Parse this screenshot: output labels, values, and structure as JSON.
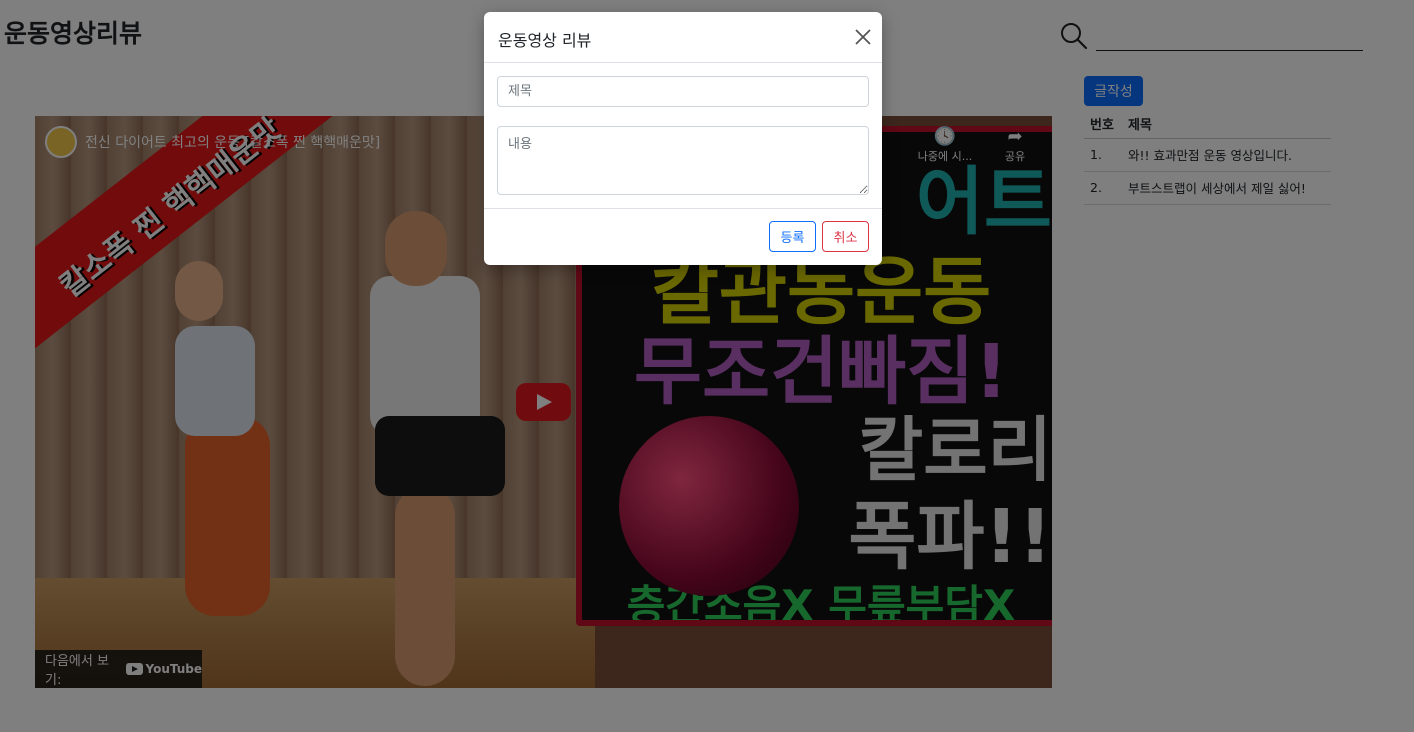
{
  "site": {
    "title": "운동영상리뷰"
  },
  "search": {
    "placeholder": ""
  },
  "toolbar": {
    "write_label": "글작성"
  },
  "table": {
    "headers": [
      "번호",
      "제목"
    ],
    "rows": [
      {
        "num": "1.",
        "title": "와!! 효과만점 운동 영상입니다."
      },
      {
        "num": "2.",
        "title": "부트스트랩이 세상에서 제일 싫어!"
      }
    ]
  },
  "video": {
    "title": "전신 다이어트 최고의 운동 [칼소폭 찐 핵핵매운맛]",
    "watch_later": "나중에 시...",
    "share": "공유",
    "watch_on": "다음에서 보기:",
    "youtube": "YouTube",
    "banner": "칼소폭 찐 핵핵매운맛",
    "poster_lines": [
      "어트",
      "칼관동운동",
      "무조건빠짐!",
      "칼로리",
      "폭파!!",
      "층간소음X 무릎부담X"
    ]
  },
  "modal": {
    "title": "운동영상 리뷰",
    "title_placeholder": "제목",
    "content_placeholder": "내용",
    "submit_label": "등록",
    "cancel_label": "취소"
  },
  "colors": {
    "primary": "#0d6efd",
    "danger": "#dc3545",
    "youtube_red": "#e0191e"
  }
}
